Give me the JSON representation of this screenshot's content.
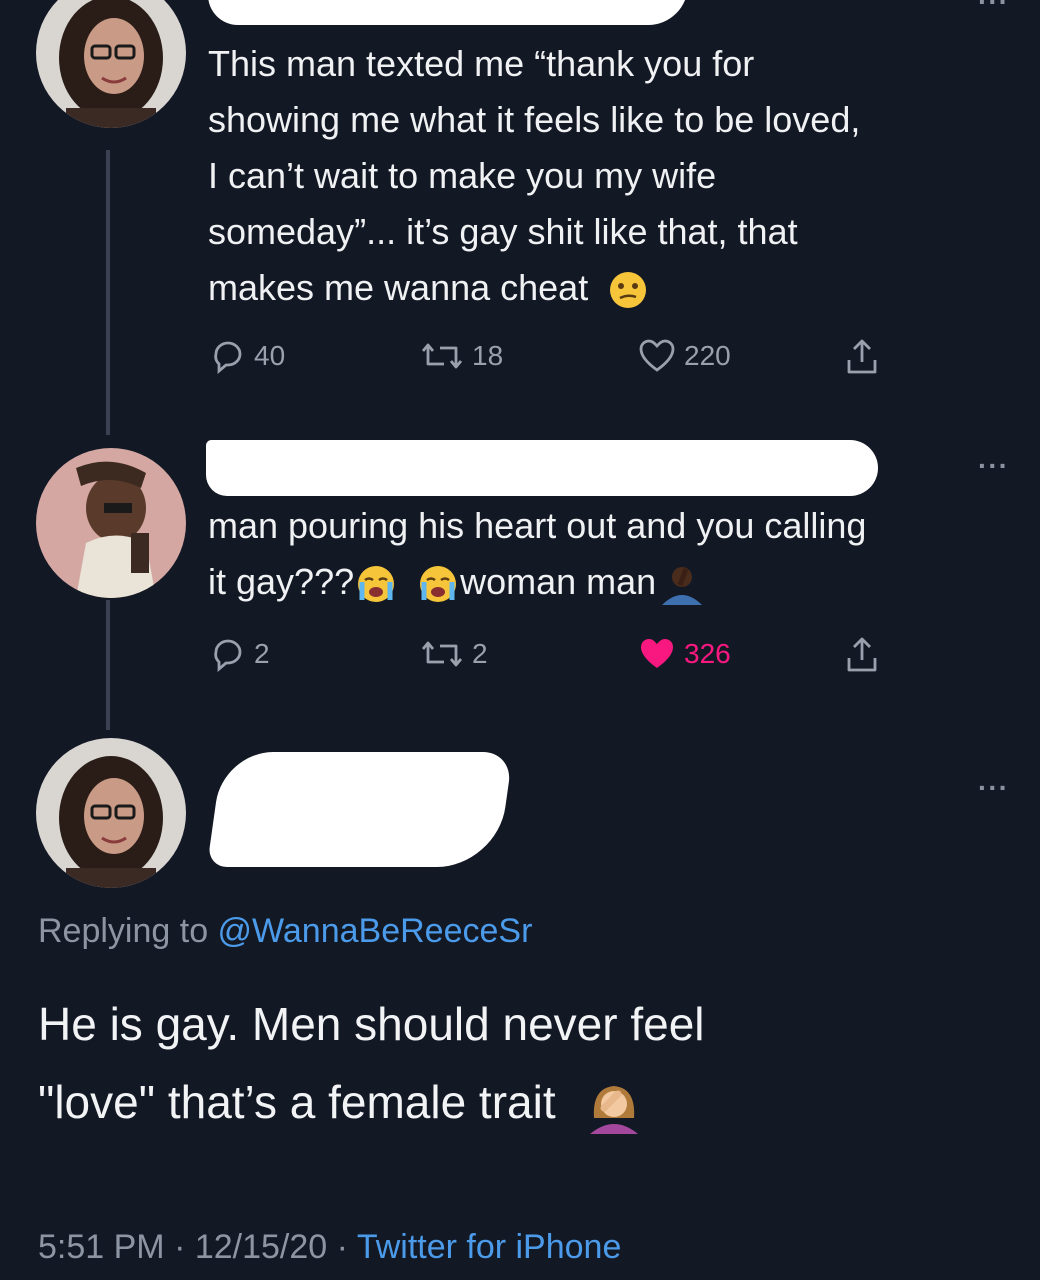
{
  "tweets": [
    {
      "text_lines": [
        "This man texted me “thank you for",
        "showing me what it feels like to be loved,",
        "I can’t wait to make you my wife",
        "someday”... it’s gay shit like that, that",
        "makes me wanna cheat"
      ],
      "emoji": "confused-face",
      "replies": "40",
      "retweets": "18",
      "likes": "220"
    },
    {
      "text_lines": [
        "man pouring his heart out and you calling",
        "it gay???",
        "woman man"
      ],
      "emojis": [
        "loudly-crying-face",
        "loudly-crying-face",
        "man-facepalming"
      ],
      "replies": "2",
      "retweets": "2",
      "likes": "326",
      "liked": true
    }
  ],
  "main_tweet": {
    "replying_prefix": "Replying to ",
    "replying_handle": "@WannaBeReeceSr",
    "text_line1": "He is gay. Men should never feel",
    "text_line2": "\"love\" that’s a female trait",
    "emoji": "woman-facepalming",
    "time": "5:51 PM",
    "separator": " · ",
    "date": "12/15/20",
    "source": "Twitter for iPhone"
  },
  "colors": {
    "background": "#131825",
    "text": "#f0f1f3",
    "muted": "#9aa1ad",
    "link": "#4b9bea",
    "like": "#f91880"
  }
}
